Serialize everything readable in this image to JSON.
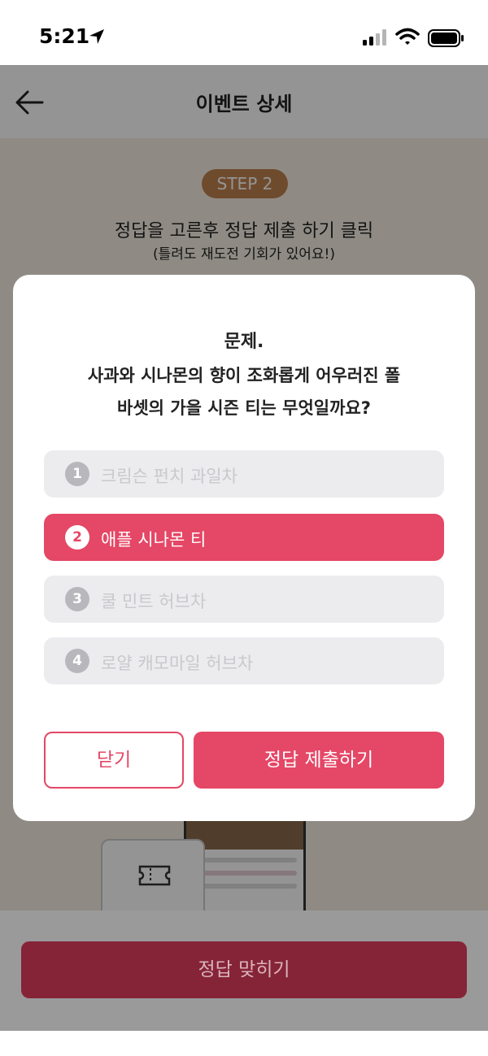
{
  "status_bar": {
    "time": "5:21"
  },
  "header": {
    "title": "이벤트 상세"
  },
  "content": {
    "step_label": "STEP 2",
    "instruction": "정답을 고른후 정답 제출 하기 클릭",
    "instruction_sub": "(틀려도 재도전 기회가 있어요!)"
  },
  "modal": {
    "question_title": "문제.",
    "question_line1": "사과와 시나몬의 향이 조화롭게 어우러진 폴",
    "question_line2": "바셋의 가을 시즌 티는 무엇일까요?",
    "options": [
      {
        "number": "1",
        "label": "크림슨 펀치 과일차",
        "selected": false
      },
      {
        "number": "2",
        "label": "애플 시나몬 티",
        "selected": true
      },
      {
        "number": "3",
        "label": "쿨 민트 허브차",
        "selected": false
      },
      {
        "number": "4",
        "label": "로얄 캐모마일 허브차",
        "selected": false
      }
    ],
    "close_label": "닫기",
    "submit_label": "정답 제출하기"
  },
  "bottom": {
    "cta_label": "정답 맞히기"
  },
  "colors": {
    "accent": "#e54766",
    "step_badge": "#c0824e",
    "cta_dimmed": "#862437"
  }
}
